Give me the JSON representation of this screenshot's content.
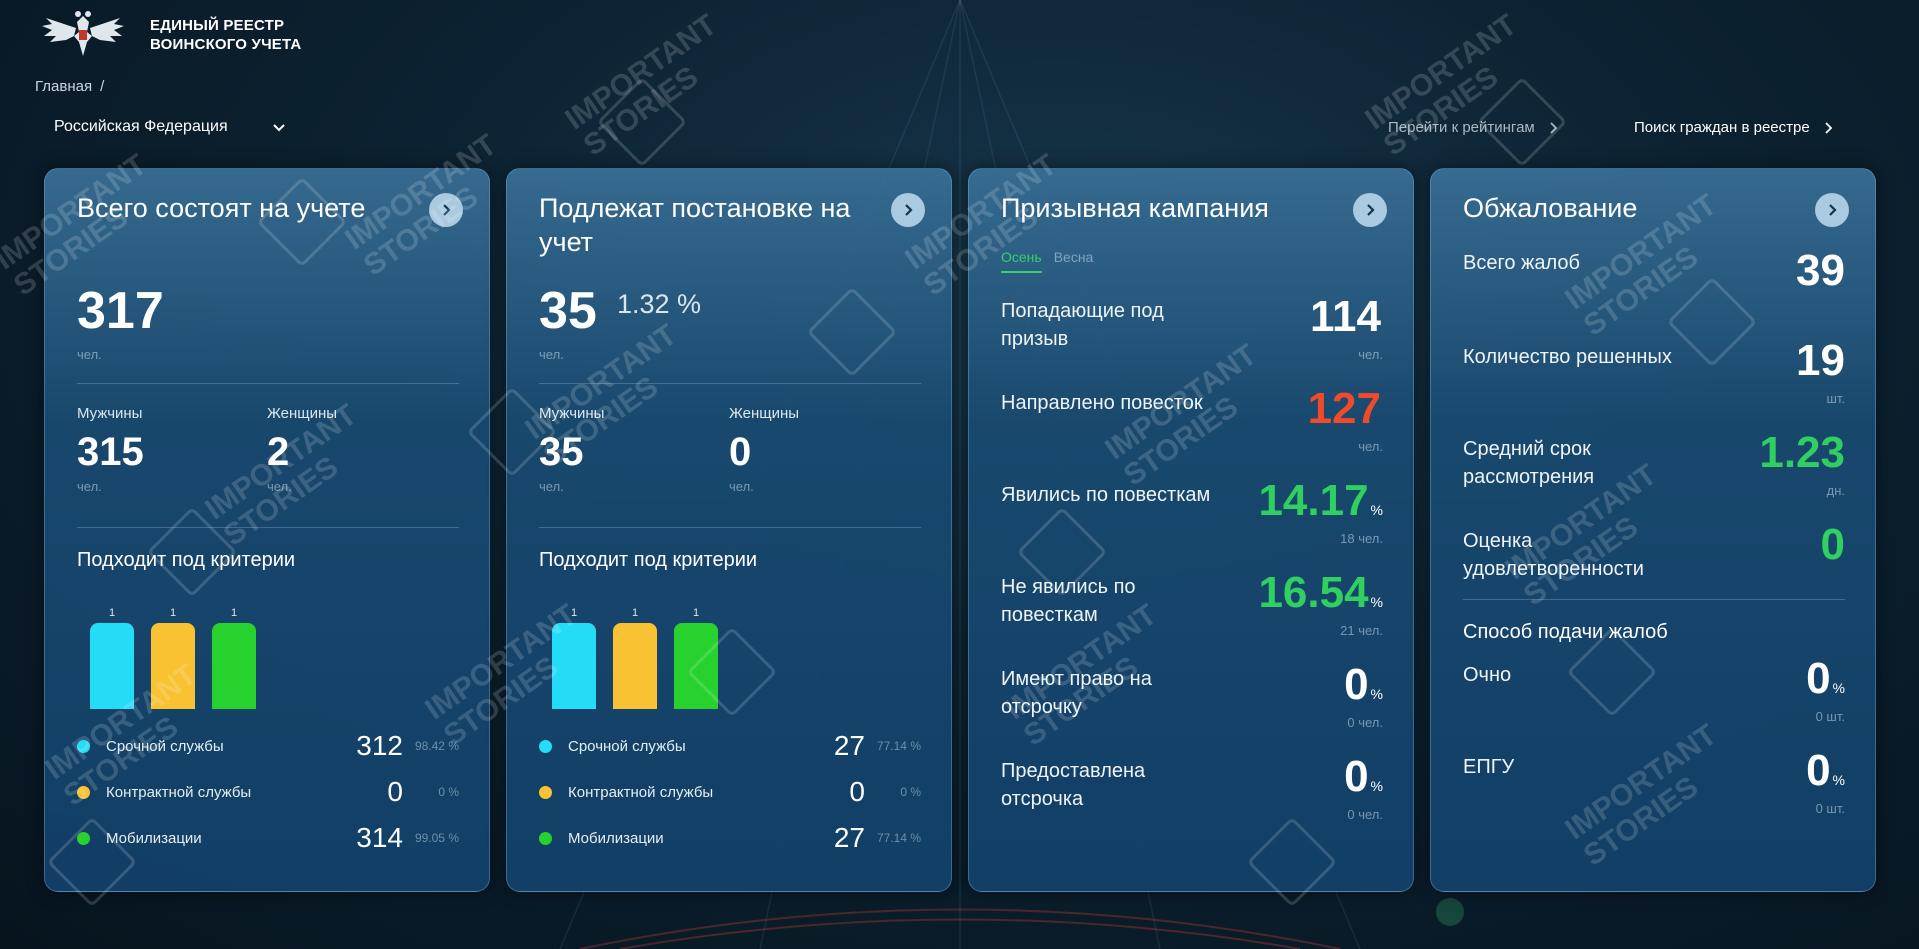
{
  "header": {
    "title_line1": "ЕДИНЫЙ РЕЕСТР",
    "title_line2": "ВОИНСКОГО УЧЕТА",
    "breadcrumb": "Главная",
    "breadcrumb_sep": "/",
    "region": "Российская Федерация",
    "ratings_link": "Перейти к рейтингам",
    "search_link": "Поиск граждан в реестре"
  },
  "card1": {
    "title": "Всего состоят на учете",
    "total": "317",
    "total_unit": "чел.",
    "men_label": "Мужчины",
    "men": "315",
    "men_unit": "чел.",
    "women_label": "Женщины",
    "women": "2",
    "women_unit": "чел.",
    "criteria_title": "Подходит под критерии",
    "bars": [
      {
        "value": "1",
        "fill": 1.0,
        "color": "#23dcf5"
      },
      {
        "value": "1",
        "fill": 1.0,
        "color": "#f8c232"
      },
      {
        "value": "1",
        "fill": 1.0,
        "color": "#27d12e"
      }
    ],
    "legend": [
      {
        "label": "Срочной службы",
        "value": "312",
        "pct": "98.42 %",
        "color": "#23dcf5"
      },
      {
        "label": "Контрактной службы",
        "value": "0",
        "pct": "0 %",
        "color": "#f8c232"
      },
      {
        "label": "Мобилизации",
        "value": "314",
        "pct": "99.05 %",
        "color": "#27d12e"
      }
    ]
  },
  "card2": {
    "title": "Подлежат постановке на учет",
    "total": "35",
    "total_pct": "1.32 %",
    "total_unit": "чел.",
    "men_label": "Мужчины",
    "men": "35",
    "men_unit": "чел.",
    "women_label": "Женщины",
    "women": "0",
    "women_unit": "чел.",
    "criteria_title": "Подходит под критерии",
    "bars": [
      {
        "value": "1",
        "fill": 1.0,
        "color": "#23dcf5"
      },
      {
        "value": "1",
        "fill": 1.0,
        "color": "#f8c232"
      },
      {
        "value": "1",
        "fill": 1.0,
        "color": "#27d12e"
      }
    ],
    "legend": [
      {
        "label": "Срочной службы",
        "value": "27",
        "pct": "77.14 %",
        "color": "#23dcf5"
      },
      {
        "label": "Контрактной службы",
        "value": "0",
        "pct": "0 %",
        "color": "#f8c232"
      },
      {
        "label": "Мобилизации",
        "value": "27",
        "pct": "77.14 %",
        "color": "#27d12e"
      }
    ]
  },
  "card3": {
    "title": "Призывная кампания",
    "tabs": [
      "Осень",
      "Весна"
    ],
    "active_tab": "Осень",
    "rows": [
      {
        "label": "Попадающие под призыв",
        "value": "114",
        "pct": "",
        "sub": "чел.",
        "color": "#ffffff"
      },
      {
        "label": "Направлено повесток",
        "value": "127",
        "pct": "",
        "sub": "чел.",
        "color": "#f04a2a"
      },
      {
        "label": "Явились по повесткам",
        "value": "14.17",
        "pct": "%",
        "sub": "18 чел.",
        "color": "#2fd05f"
      },
      {
        "label": "Не явились по повесткам",
        "value": "16.54",
        "pct": "%",
        "sub": "21 чел.",
        "color": "#2fd05f"
      },
      {
        "label": "Имеют право на отсрочку",
        "value": "0",
        "pct": "%",
        "sub": "0 чел.",
        "color": "#ffffff"
      },
      {
        "label": "Предоставлена отсрочка",
        "value": "0",
        "pct": "%",
        "sub": "0 чел.",
        "color": "#ffffff"
      }
    ]
  },
  "card4": {
    "title": "Обжалование",
    "rows": [
      {
        "label": "Всего жалоб",
        "value": "39",
        "sub": "",
        "color": "#ffffff"
      },
      {
        "label": "Количество решенных",
        "value": "19",
        "sub": "шт.",
        "color": "#ffffff"
      },
      {
        "label": "Средний срок рассмотрения",
        "value": "1.23",
        "sub": "дн.",
        "color": "#2fd05f"
      },
      {
        "label": "Оценка удовлетворенности",
        "value": "0",
        "sub": "",
        "color": "#2fd05f"
      }
    ],
    "method_title": "Способ подачи жалоб",
    "methods": [
      {
        "label": "Очно",
        "value": "0",
        "pct": "%",
        "sub": "0 шт."
      },
      {
        "label": "ЕПГУ",
        "value": "0",
        "pct": "%",
        "sub": "0 шт."
      }
    ]
  },
  "watermark": {
    "line1": "IMPORTANT",
    "line2": "STORIES",
    "icon_letter": "i"
  }
}
